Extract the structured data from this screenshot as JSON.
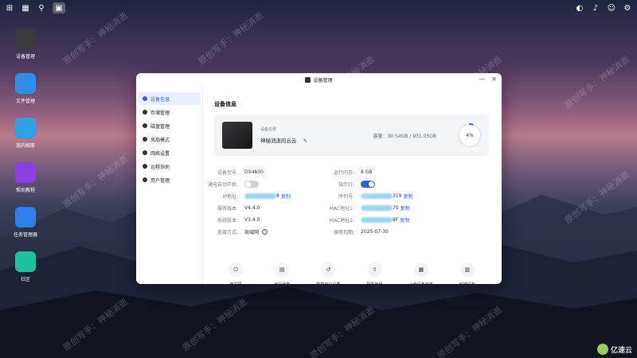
{
  "desktop": {
    "icons": [
      {
        "label": "设备管理",
        "icon": "device-icon",
        "color": "#3a3a3e"
      },
      {
        "label": "文件管理",
        "icon": "folder-icon",
        "color": "#2f8fe6"
      },
      {
        "label": "我的相册",
        "icon": "photo-icon",
        "color": "#2f9fe6"
      },
      {
        "label": "帮助教程",
        "icon": "help-icon",
        "color": "#8a3fe0"
      },
      {
        "label": "任务管理器",
        "icon": "chart-icon",
        "color": "#2e7fe8"
      },
      {
        "label": "社区",
        "icon": "community-icon",
        "color": "#1dc39a"
      }
    ]
  },
  "window": {
    "title": "设备管理",
    "sidebar": [
      {
        "label": "设备信息",
        "icon": "info-icon",
        "active": true
      },
      {
        "label": "存储管理",
        "icon": "storage-icon",
        "active": false
      },
      {
        "label": "磁盘管理",
        "icon": "disk-icon",
        "active": false
      },
      {
        "label": "风扇模式",
        "icon": "fan-icon",
        "active": false
      },
      {
        "label": "网络设置",
        "icon": "network-icon",
        "active": false
      },
      {
        "label": "远程协助",
        "icon": "remote-icon",
        "active": false
      },
      {
        "label": "用户管理",
        "icon": "user-icon",
        "active": false
      }
    ],
    "section_title": "设备信息",
    "device": {
      "name_label": "设备名称",
      "name": "神秘消逝的云云",
      "capacity": "容量：30.54GB / 931.05GB",
      "percent_text": "4%",
      "percent": 4
    },
    "info_left": [
      {
        "k": "设备型号:",
        "v": "DX4600"
      },
      {
        "k": "通电自动开机:",
        "toggle": false
      },
      {
        "k": "IP地址:",
        "blurred": true,
        "v": "8",
        "link": "复制"
      },
      {
        "k": "服务版本:",
        "v": "V4.4.0"
      },
      {
        "k": "系统版本:",
        "v": "V3.4.0"
      },
      {
        "k": "连接方式:",
        "v": "局域网"
      }
    ],
    "info_right": [
      {
        "k": "运行内存:",
        "v": "8 GB"
      },
      {
        "k": "指示灯:",
        "toggle": true
      },
      {
        "k": "序列号:",
        "blurred": true,
        "v": "319",
        "link": "复制"
      },
      {
        "k": "MAC地址1:",
        "blurred": true,
        "v": "70",
        "link": "复制"
      },
      {
        "k": "MAC地址2:",
        "blurred": true,
        "v": "8F",
        "link": "复制"
      },
      {
        "k": "保修到期:",
        "v": "2025-07-30"
      }
    ],
    "actions": [
      {
        "label": "开关机",
        "icon": "power-icon",
        "glyph": "⏻"
      },
      {
        "label": "运行状态",
        "icon": "monitor-icon",
        "glyph": "▤"
      },
      {
        "label": "恢复出厂设置",
        "icon": "reset-icon",
        "glyph": "↺"
      },
      {
        "label": "固件升级",
        "icon": "upgrade-icon",
        "glyph": "⇧"
      },
      {
        "label": "上传设备日志",
        "icon": "log-icon",
        "glyph": "▦"
      },
      {
        "label": "解绑设备",
        "icon": "unbind-icon",
        "glyph": "▥"
      }
    ]
  },
  "watermark_text": "原创写手：神秘消逝",
  "corner_logo": "亿速云"
}
